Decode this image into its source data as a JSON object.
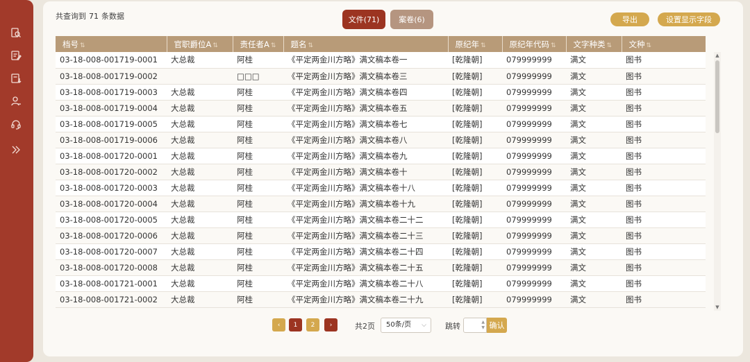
{
  "sidebar": {
    "icons": [
      "search-file-icon",
      "edit-doc-icon",
      "download-doc-icon",
      "user-icon",
      "headset-icon",
      "expand-icon"
    ]
  },
  "summary": {
    "prefix": "共查询到",
    "count": "71",
    "suffix": "条数据"
  },
  "tabs": {
    "files": "文件(71)",
    "volumes": "案卷(6)"
  },
  "actions": {
    "export": "导出",
    "fields": "设置显示字段"
  },
  "table": {
    "columns": [
      "档号",
      "官职爵位A",
      "责任者A",
      "题名",
      "原纪年",
      "原纪年代码",
      "文字种类",
      "文种"
    ],
    "rows": [
      [
        "03-18-008-001719-0001",
        "大总裁",
        "阿桂",
        "《平定两金川方略》满文稿本卷一",
        "[乾隆朝]",
        "079999999",
        "满文",
        "图书"
      ],
      [
        "03-18-008-001719-0002",
        "",
        "□□□",
        "《平定两金川方略》满文稿本卷三",
        "[乾隆朝]",
        "079999999",
        "满文",
        "图书"
      ],
      [
        "03-18-008-001719-0003",
        "大总裁",
        "阿桂",
        "《平定两金川方略》满文稿本卷四",
        "[乾隆朝]",
        "079999999",
        "满文",
        "图书"
      ],
      [
        "03-18-008-001719-0004",
        "大总裁",
        "阿桂",
        "《平定两金川方略》满文稿本卷五",
        "[乾隆朝]",
        "079999999",
        "满文",
        "图书"
      ],
      [
        "03-18-008-001719-0005",
        "大总裁",
        "阿桂",
        "《平定两金川方略》满文稿本卷七",
        "[乾隆朝]",
        "079999999",
        "满文",
        "图书"
      ],
      [
        "03-18-008-001719-0006",
        "大总裁",
        "阿桂",
        "《平定两金川方略》满文稿本卷八",
        "[乾隆朝]",
        "079999999",
        "满文",
        "图书"
      ],
      [
        "03-18-008-001720-0001",
        "大总裁",
        "阿桂",
        "《平定两金川方略》满文稿本卷九",
        "[乾隆朝]",
        "079999999",
        "满文",
        "图书"
      ],
      [
        "03-18-008-001720-0002",
        "大总裁",
        "阿桂",
        "《平定两金川方略》满文稿本卷十",
        "[乾隆朝]",
        "079999999",
        "满文",
        "图书"
      ],
      [
        "03-18-008-001720-0003",
        "大总裁",
        "阿桂",
        "《平定两金川方略》满文稿本卷十八",
        "[乾隆朝]",
        "079999999",
        "满文",
        "图书"
      ],
      [
        "03-18-008-001720-0004",
        "大总裁",
        "阿桂",
        "《平定两金川方略》满文稿本卷十九",
        "[乾隆朝]",
        "079999999",
        "满文",
        "图书"
      ],
      [
        "03-18-008-001720-0005",
        "大总裁",
        "阿桂",
        "《平定两金川方略》满文稿本卷二十二",
        "[乾隆朝]",
        "079999999",
        "满文",
        "图书"
      ],
      [
        "03-18-008-001720-0006",
        "大总裁",
        "阿桂",
        "《平定两金川方略》满文稿本卷二十三",
        "[乾隆朝]",
        "079999999",
        "满文",
        "图书"
      ],
      [
        "03-18-008-001720-0007",
        "大总裁",
        "阿桂",
        "《平定两金川方略》满文稿本卷二十四",
        "[乾隆朝]",
        "079999999",
        "满文",
        "图书"
      ],
      [
        "03-18-008-001720-0008",
        "大总裁",
        "阿桂",
        "《平定两金川方略》满文稿本卷二十五",
        "[乾隆朝]",
        "079999999",
        "满文",
        "图书"
      ],
      [
        "03-18-008-001721-0001",
        "大总裁",
        "阿桂",
        "《平定两金川方略》满文稿本卷二十八",
        "[乾隆朝]",
        "079999999",
        "满文",
        "图书"
      ],
      [
        "03-18-008-001721-0002",
        "大总裁",
        "阿桂",
        "《平定两金川方略》满文稿本卷二十九",
        "[乾隆朝]",
        "079999999",
        "满文",
        "图书"
      ]
    ]
  },
  "pagination": {
    "prev": "‹",
    "pages": [
      "1",
      "2"
    ],
    "next": "›",
    "total": "共2页",
    "page_size": "50条/页",
    "jump_label": "跳转",
    "jump_button": "确认"
  },
  "colors": {
    "sidebar": "#a23a2a",
    "header": "#b89b78",
    "primary": "#9c3421",
    "accent": "#d4a84e"
  }
}
